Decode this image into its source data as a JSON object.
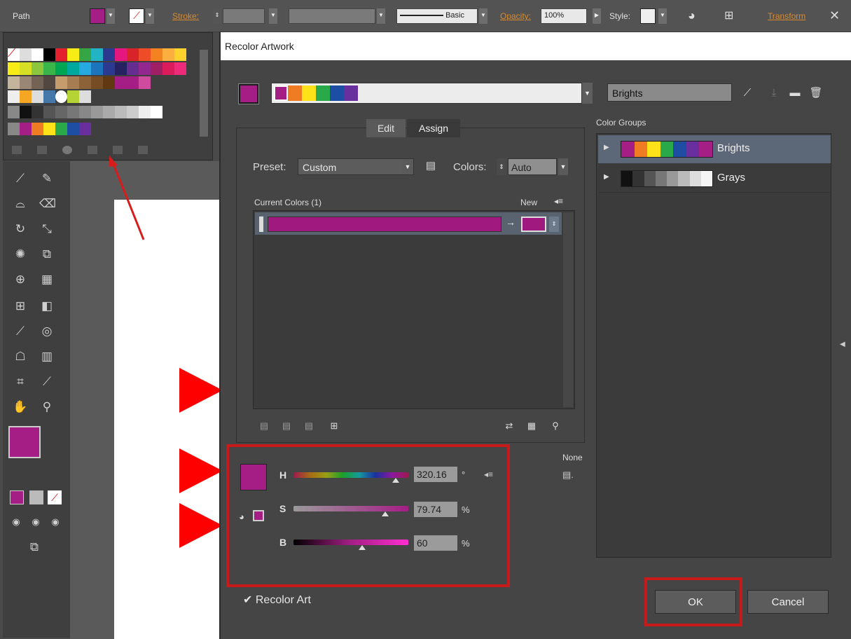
{
  "topbar": {
    "selection_label": "Path",
    "stroke_label": "Stroke:",
    "stroke_profile": "Basic",
    "opacity_label": "Opacity:",
    "opacity_value": "100%",
    "style_label": "Style:",
    "transform_label": "Transform",
    "fill_color": "#a51e86"
  },
  "dialog": {
    "title": "Recolor Artwork",
    "group_name": "Brights",
    "tabs": {
      "edit": "Edit",
      "assign": "Assign"
    },
    "preset_label": "Preset:",
    "preset_value": "Custom",
    "colors_label": "Colors:",
    "colors_value": "Auto",
    "current_colors_label": "Current Colors (1)",
    "new_label": "New",
    "current_color": "#a0197f",
    "hsb": {
      "h_label": "H",
      "h_value": "320.16",
      "h_unit": "°",
      "h_fraction": 0.89,
      "s_label": "S",
      "s_value": "79.74",
      "s_unit": "%",
      "s_fraction": 0.7974,
      "b_label": "B",
      "b_value": "60",
      "b_unit": "%",
      "b_fraction": 0.6
    },
    "color_groups_label": "Color Groups",
    "color_groups": [
      {
        "name": "Brights",
        "colors": [
          "#a51e86",
          "#ef7b23",
          "#fde21a",
          "#2aa94a",
          "#1d4ea3",
          "#6a2f9e",
          "#a51e86"
        ]
      },
      {
        "name": "Grays",
        "colors": [
          "#111111",
          "#333333",
          "#555555",
          "#777777",
          "#999999",
          "#bbbbbb",
          "#dddddd",
          "#f5f5f5"
        ]
      }
    ],
    "none_label": "None",
    "recolor_art_label": "Recolor Art",
    "ok_label": "OK",
    "cancel_label": "Cancel"
  }
}
